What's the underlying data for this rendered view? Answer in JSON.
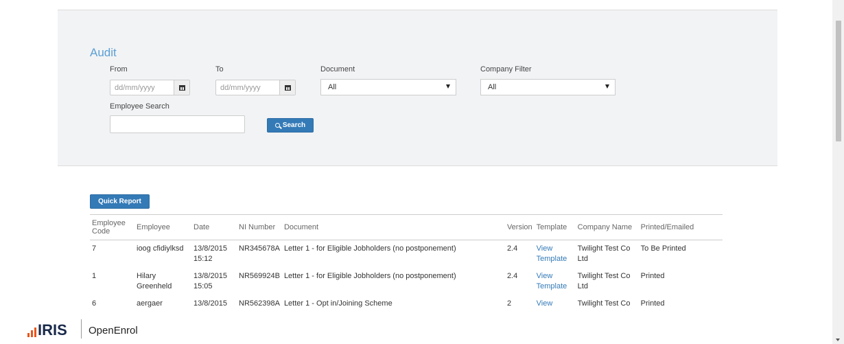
{
  "audit": {
    "title": "Audit",
    "from_label": "From",
    "to_label": "To",
    "from_placeholder": "dd/mm/yyyy",
    "to_placeholder": "dd/mm/yyyy",
    "document_label": "Document",
    "document_value": "All",
    "company_label": "Company Filter",
    "company_value": "All",
    "employee_search_label": "Employee Search",
    "employee_search_value": "",
    "search_button": "Search"
  },
  "report": {
    "quick_report_button": "Quick Report",
    "columns": [
      "Employee Code",
      "Employee",
      "Date",
      "NI Number",
      "Document",
      "Version",
      "Template",
      "Company Name",
      "Printed/Emailed"
    ],
    "rows": [
      {
        "code": "7",
        "employee": "ioog cfidiylksd",
        "date": "13/8/2015 15:12",
        "ni": "NR345678A",
        "document": "Letter 1 - for Eligible Jobholders (no postponement)",
        "version": "2.4",
        "template": "View Template",
        "company": "Twilight Test Co Ltd",
        "status": "To Be Printed"
      },
      {
        "code": "1",
        "employee": "Hilary Greenheld",
        "date": "13/8/2015 15:05",
        "ni": "NR569924B",
        "document": "Letter 1 - for Eligible Jobholders (no postponement)",
        "version": "2.4",
        "template": "View Template",
        "company": "Twilight Test Co Ltd",
        "status": "Printed"
      },
      {
        "code": "6",
        "employee": "aergaer",
        "date": "13/8/2015",
        "ni": "NR562398A",
        "document": "Letter 1 - Opt in/Joining Scheme",
        "version": "2",
        "template": "View",
        "company": "Twilight Test Co",
        "status": "Printed"
      }
    ]
  },
  "footer": {
    "brand": "IRIS",
    "app_name": "OpenEnrol"
  },
  "colors": {
    "accent": "#337ab7",
    "title": "#5a9fd4",
    "logo_bars": "#e8551c"
  }
}
